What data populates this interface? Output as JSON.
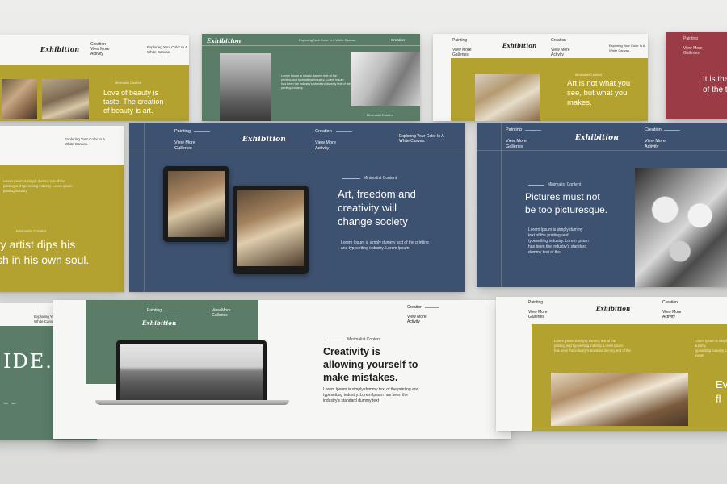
{
  "colors": {
    "olive": "#b3a230",
    "green": "#5b7d68",
    "navy": "#3d5170",
    "maroon": "#9b3b46",
    "white": "#f6f6f4",
    "background": "#e6e6e4"
  },
  "brand": "Exhibition",
  "nav": {
    "painting": "Painting",
    "view_more": "View  More",
    "galleries": "Galleries",
    "creation": "Creation",
    "activity": "Activity",
    "exploring": "Exploring Your Color In A",
    "white_canvas": "White Canvas.",
    "exploring_full": "Exploring Your Color In A White Canvas."
  },
  "kicker": "Minimalist Content",
  "lorem": {
    "two_line_a": "Lorem Ipsum is simply dummy text of the printing",
    "two_line_b": "and typesetting industry. Lorem Ipsum",
    "three_line_a": "Lorem Ipsum is simply dummy text of the printing and",
    "three_line_b": "typesetting industry. Lorem Ipsum has been the",
    "three_line_c": "industry's standard dummy text",
    "short_a": "Lorem Ipsum is simply dummy",
    "short_b": "text of the printing and",
    "short_c": "typesetting industry. Lorem Ipsum",
    "short_d": "has been the industry's standard",
    "short_e": "dummy text of the",
    "mini_a": "Lorem Ipsum is simply dummy text of the",
    "mini_b": "printing and typesetting industry. Lorem Ipsum",
    "mini_c": "has been the industry's standard dummy text of the",
    "mini_d": "printing industry"
  },
  "slides": {
    "top_left": {
      "heading": [
        "Love of beauty is",
        "taste. The creation",
        "of beauty is art."
      ]
    },
    "top_olive": {
      "heading": [
        "Art is not what you",
        "see, but what you",
        "makes."
      ]
    },
    "top_maroon": {
      "heading": [
        "It is the",
        "of the t"
      ]
    },
    "mid_left": {
      "heading": [
        "ry artist dips his",
        "sh in his own soul."
      ]
    },
    "center_navy": {
      "heading": [
        "Art, freedom and",
        "creativity will",
        "change society"
      ]
    },
    "right_navy": {
      "heading": [
        "Pictures must not",
        "be too picturesque."
      ]
    },
    "bottom_left": {
      "heading": "IDE."
    },
    "bottom_center": {
      "heading": [
        "Creativity is",
        "allowing yourself to",
        "make mistakes."
      ]
    },
    "bottom_right": {
      "heading": [
        "Ev",
        "fl"
      ]
    }
  }
}
